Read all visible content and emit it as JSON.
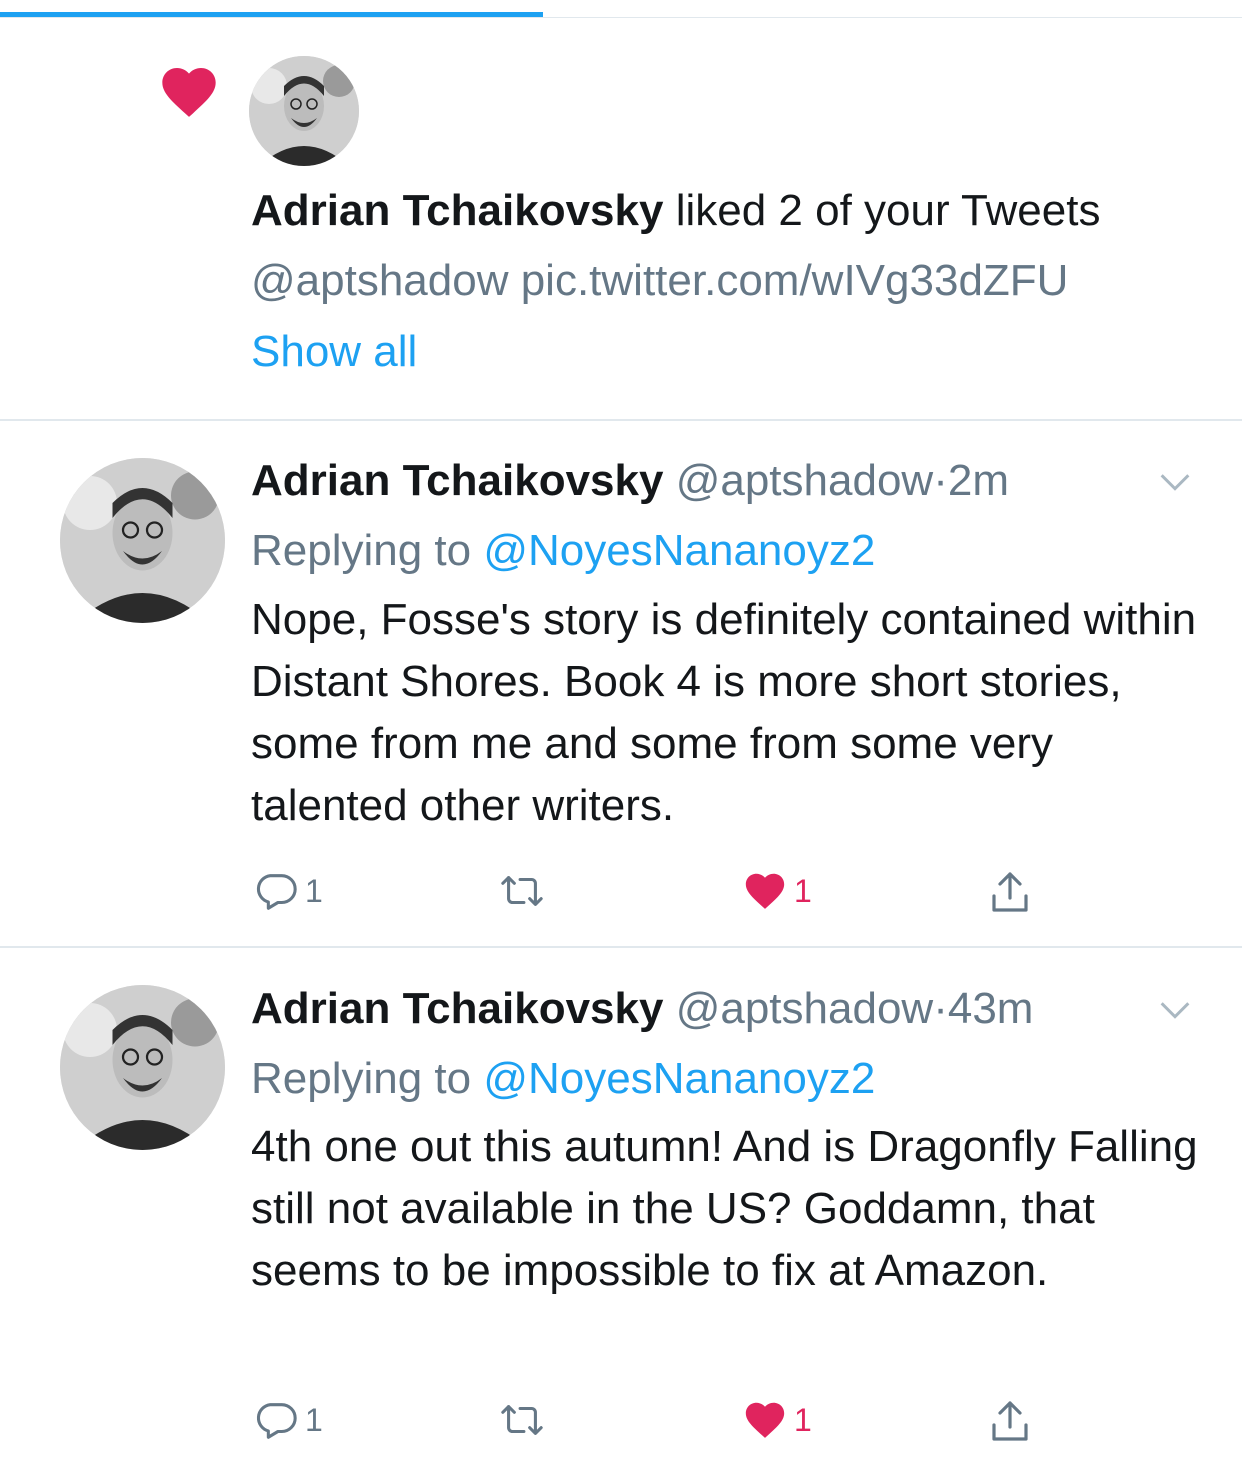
{
  "progress": {
    "fraction": 0.437,
    "color": "#1da1f2"
  },
  "notification": {
    "icon": "heart-icon",
    "user_name": "Adrian Tchaikovsky",
    "action_text": " liked 2 of your Tweets",
    "tweet_preview": "@aptshadow pic.twitter.com/wIVg33dZFU",
    "show_all": "Show all"
  },
  "tweets": [
    {
      "name": "Adrian Tchaikovsky",
      "handle": "@aptshadow",
      "separator": "·",
      "time": "2m",
      "replying_prefix": "Replying to ",
      "replying_to": "@NoyesNananoyz2",
      "text": "Nope, Fosse's story is definitely contained within Distant Shores. Book 4 is more short stories, some from me and some from some very talented other writers.",
      "replies": "1",
      "retweets": "",
      "likes": "1",
      "liked": true
    },
    {
      "name": "Adrian Tchaikovsky",
      "handle": "@aptshadow",
      "separator": "·",
      "time": "43m",
      "replying_prefix": "Replying to ",
      "replying_to": "@NoyesNananoyz2",
      "text": "4th one out this autumn! And is Dragonfly Falling still not available in the US? Goddamn, that seems to be impossible to fix at Amazon.",
      "replies": "1",
      "retweets": "",
      "likes": "1",
      "liked": true
    }
  ],
  "colors": {
    "accent": "#1da1f2",
    "like": "#e0245e",
    "muted": "#657786",
    "text": "#14171a"
  }
}
